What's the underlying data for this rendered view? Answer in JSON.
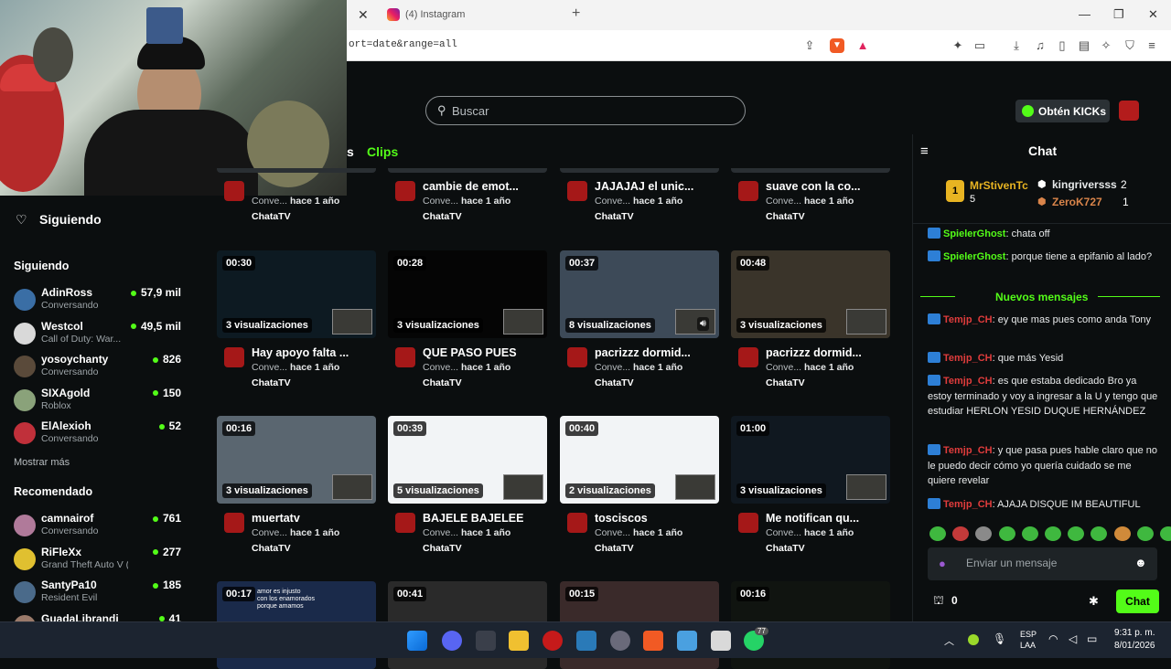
{
  "browser": {
    "tab_close": "✕",
    "tab_title": "(4) Instagram",
    "new_tab": "+",
    "url": "ort=date&range=all",
    "minimize": "—",
    "maximize": "❐",
    "close": "✕"
  },
  "header": {
    "search_placeholder": "Buscar",
    "kicks_label": "Obtén KICKs"
  },
  "sidebar": {
    "following_title": "Siguiendo",
    "following_section": "Siguiendo",
    "following": [
      {
        "name": "AdinRoss",
        "sub": "Conversando",
        "viewers": "57,9 mil",
        "color": "#3a6ea5"
      },
      {
        "name": "Westcol",
        "sub": "Call of Duty: War...",
        "viewers": "49,5 mil",
        "color": "#d9d9d9"
      },
      {
        "name": "yosoychanty",
        "sub": "Conversando",
        "viewers": "826",
        "color": "#5a4a3a"
      },
      {
        "name": "SIXAgold",
        "sub": "Roblox",
        "viewers": "150",
        "color": "#8aa27a"
      },
      {
        "name": "ElAlexioh",
        "sub": "Conversando",
        "viewers": "52",
        "color": "#c0303a"
      }
    ],
    "show_more": "Mostrar más",
    "recommended_section": "Recomendado",
    "recommended": [
      {
        "name": "camnairof",
        "sub": "Conversando",
        "viewers": "761",
        "color": "#b07a9a"
      },
      {
        "name": "RiFleXx",
        "sub": "Grand Theft Auto V (G...",
        "viewers": "277",
        "color": "#e0c030"
      },
      {
        "name": "SantyPa10",
        "sub": "Resident Evil",
        "viewers": "185",
        "color": "#4a6a8a"
      },
      {
        "name": "GuadaLibrandi",
        "sub": "",
        "viewers": "41",
        "color": "#9a7a6a"
      }
    ]
  },
  "tabs": {
    "partial": "s",
    "clips": "Clips"
  },
  "clips_row0": [
    {
      "title": "",
      "meta_prefix": "Conve...",
      "time": "hace 1 año",
      "channel": "ChataTV"
    },
    {
      "title": "cambie de emot...",
      "meta_prefix": "Conve...",
      "time": "hace 1 año",
      "channel": "ChataTV"
    },
    {
      "title": "JAJAJAJ el unic...",
      "meta_prefix": "Conve...",
      "time": "hace 1 año",
      "channel": "ChataTV"
    },
    {
      "title": "suave con la co...",
      "meta_prefix": "Conve...",
      "time": "hace 1 año",
      "channel": "ChataTV"
    }
  ],
  "clips_row1": [
    {
      "duration": "00:30",
      "views": "3 visualizaciones",
      "title": "Hay apoyo falta ...",
      "meta_prefix": "Conve...",
      "time": "hace 1 año",
      "channel": "ChataTV",
      "bg": "#0d1a22"
    },
    {
      "duration": "00:28",
      "views": "3 visualizaciones",
      "title": "QUE PASO PUES",
      "meta_prefix": "Conve...",
      "time": "hace 1 año",
      "channel": "ChataTV",
      "bg": "#050505"
    },
    {
      "duration": "00:37",
      "views": "8 visualizaciones",
      "title": "pacrizzz dormid...",
      "meta_prefix": "Conve...",
      "time": "hace 1 año",
      "channel": "ChataTV",
      "bg": "#3d4a58"
    },
    {
      "duration": "00:48",
      "views": "3 visualizaciones",
      "title": "pacrizzz dormid...",
      "meta_prefix": "Conve...",
      "time": "hace 1 año",
      "channel": "ChataTV",
      "bg": "#3a342a"
    }
  ],
  "clips_row2": [
    {
      "duration": "00:16",
      "views": "3 visualizaciones",
      "title": "muertatv",
      "meta_prefix": "Conve...",
      "time": "hace 1 año",
      "channel": "ChataTV",
      "bg": "#5a6670"
    },
    {
      "duration": "00:39",
      "views": "5 visualizaciones",
      "title": "BAJELE BAJELEE",
      "meta_prefix": "Conve...",
      "time": "hace 1 año",
      "channel": "ChataTV",
      "bg": "#f2f4f6"
    },
    {
      "duration": "00:40",
      "views": "2 visualizaciones",
      "title": "tosciscos",
      "meta_prefix": "Conve...",
      "time": "hace 1 año",
      "channel": "ChataTV",
      "bg": "#f2f4f6"
    },
    {
      "duration": "01:00",
      "views": "3 visualizaciones",
      "title": "Me notifican qu...",
      "meta_prefix": "Conve...",
      "time": "hace 1 año",
      "channel": "ChataTV",
      "bg": "#101820"
    }
  ],
  "clips_row3": [
    {
      "duration": "00:17",
      "caption": "amor es injusto\ncon los enamorados\nporque amamos",
      "bg": "#1a2a4a"
    },
    {
      "duration": "00:41",
      "bg": "#2a2a2a"
    },
    {
      "duration": "00:15",
      "bg": "#3a2a2a"
    },
    {
      "duration": "00:16",
      "bg": "#101410"
    }
  ],
  "chat": {
    "title": "Chat",
    "top_gifter_1": "MrStivenTc",
    "top_gifter_1_count": "5",
    "top_gifter_2": "kingriversss",
    "top_gifter_2_count": "2",
    "top_gifter_3": "ZeroK727",
    "top_gifter_3_count": "1",
    "new_messages": "Nuevos mensajes",
    "messages_before": [
      {
        "user": "SpielerGhost",
        "text": ": chata off"
      },
      {
        "user": "SpielerGhost",
        "text": ": porque tiene a epifanio al lado?"
      }
    ],
    "messages_after": [
      {
        "user": "Temjp_CH",
        "text": ": ey que mas pues como anda Tony"
      },
      {
        "user": "Temjp_CH",
        "text": ": que más Yesid"
      },
      {
        "user": "Temjp_CH",
        "text": ": es que estaba dedicado Bro ya estoy terminado y voy a ingresar a la U y tengo que estudiar HERLON YESID DUQUE HERNÁNDEZ"
      },
      {
        "user": "Temjp_CH",
        "text": ": y que pasa pues hable claro que no le puedo decir cómo yo quería cuidado se me quiere revelar"
      },
      {
        "user": "Temjp_CH",
        "text": ": AJAJA DISQUE IM BEAUTIFUL"
      }
    ],
    "input_placeholder": "Enviar un mensaje",
    "points": "0",
    "send_label": "Chat"
  },
  "taskbar": {
    "lang_1": "ESP",
    "lang_2": "LAA",
    "time": "9:31 p. m.",
    "date": "8/01/2026",
    "whatsapp_badge": "77"
  }
}
